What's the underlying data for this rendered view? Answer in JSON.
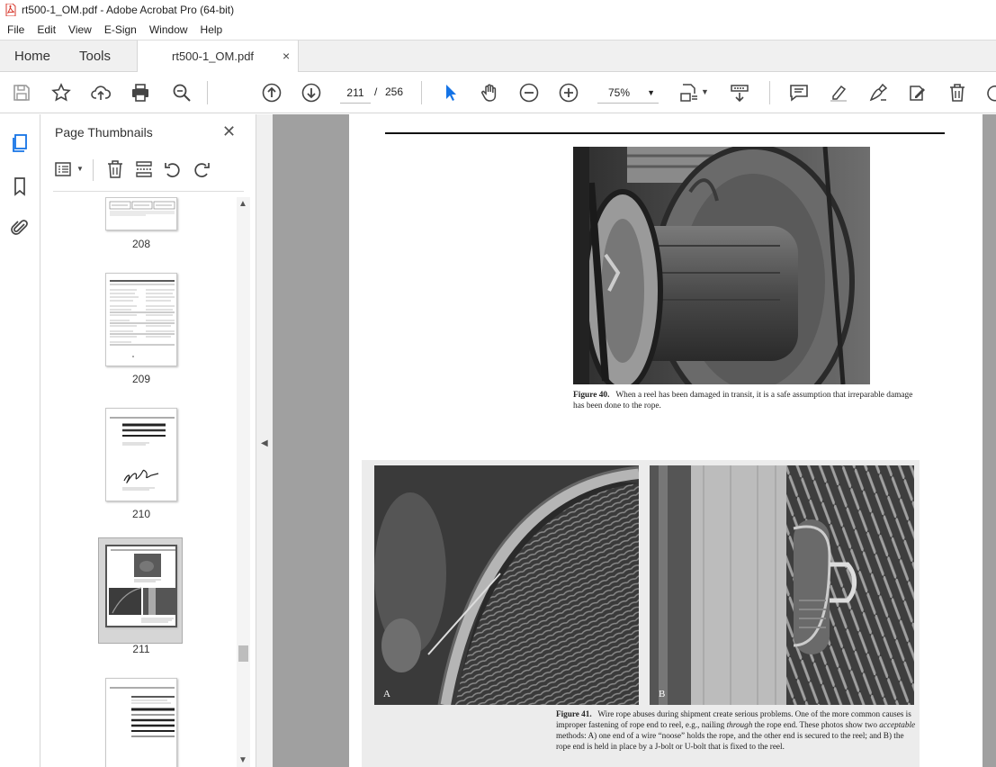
{
  "window": {
    "title": "rt500-1_OM.pdf - Adobe Acrobat Pro (64-bit)"
  },
  "menu": [
    "File",
    "Edit",
    "View",
    "E-Sign",
    "Window",
    "Help"
  ],
  "tabs": {
    "home": "Home",
    "tools": "Tools",
    "document": "rt500-1_OM.pdf",
    "close": "×"
  },
  "toolbar": {
    "current_page": "211",
    "page_separator": "/",
    "total_pages": "256",
    "zoom": "75%"
  },
  "panel": {
    "title": "Page Thumbnails",
    "close": "✕"
  },
  "thumbnails": [
    {
      "label": "208"
    },
    {
      "label": "209"
    },
    {
      "label": "210"
    },
    {
      "label": "211",
      "selected": true
    },
    {
      "label": ""
    }
  ],
  "page": {
    "fig40": {
      "number": "Figure 40.",
      "text": "When a reel has been damaged in transit, it is a safe assumption that irreparable damage has been done to the rope."
    },
    "fig41": {
      "tag_a": "A",
      "tag_b": "B",
      "number": "Figure 41.",
      "text1": "Wire rope abuses during shipment create serious problems. One of the more common causes is improper fastening of rope end to reel, e.g., nailing ",
      "em1": "through",
      "text2": " the rope end. These photos show two ",
      "em2": "acceptable",
      "text3": " methods: A) one end of a wire “noose” holds the rope, and the other end is secured to the reel; and B) the rope end is held in place by a J-bolt or U-bolt that is fixed to the reel."
    }
  },
  "colors": {
    "accent_blue": "#1473e6",
    "pdf_red": "#d7372b",
    "doc_bg": "#a0a0a0"
  }
}
